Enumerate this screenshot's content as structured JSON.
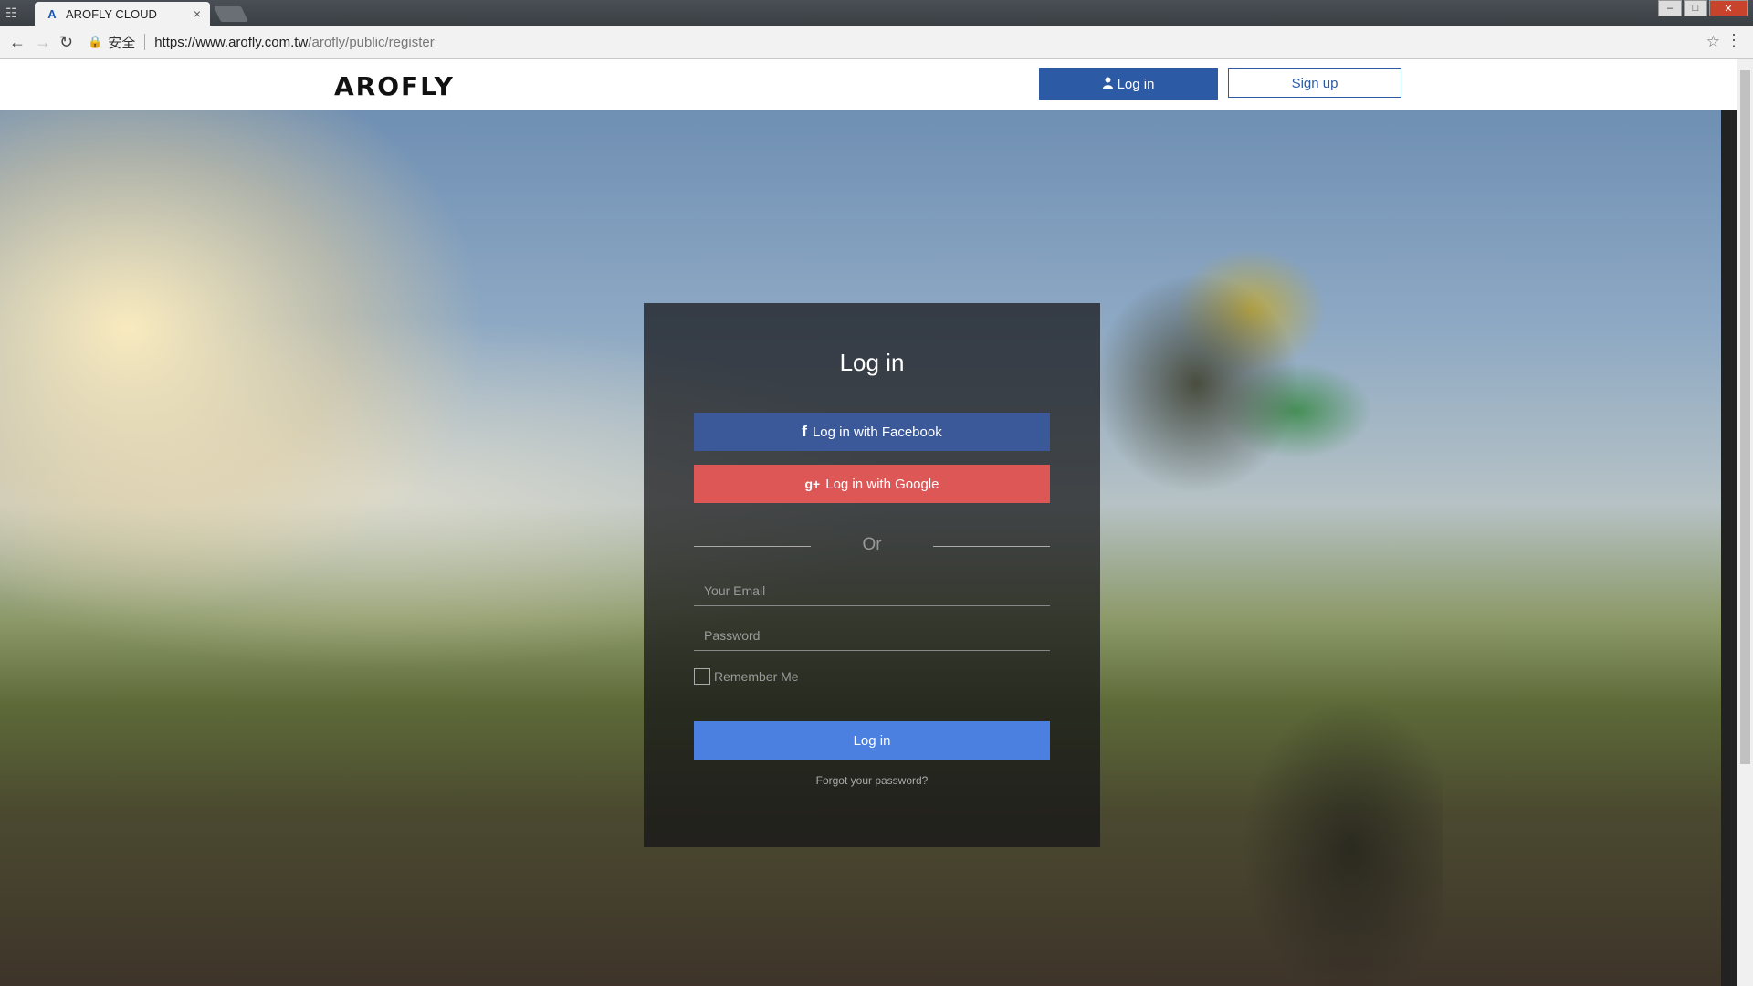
{
  "browser": {
    "tab_title": "AROFLY CLOUD",
    "tab_favicon": "A",
    "tab_close": "×",
    "security_label": "安全",
    "url_host": "https://www.arofly.com.tw",
    "url_path": "/arofly/public/register"
  },
  "header": {
    "logo": "AROFLY",
    "login_label": "Log in",
    "signup_label": "Sign up"
  },
  "login_card": {
    "title": "Log in",
    "facebook_label": "Log in with Facebook",
    "google_label": "Log in with Google",
    "or_label": "Or",
    "email_placeholder": "Your Email",
    "password_placeholder": "Password",
    "remember_label": "Remember Me",
    "submit_label": "Log in",
    "forgot_label": "Forgot your password?"
  },
  "colors": {
    "primary": "#2d5aa5",
    "facebook": "#3b5998",
    "google": "#dd5757",
    "login_button": "#4b7fe0"
  },
  "icons": {
    "user": "user-icon",
    "facebook": "facebook-icon",
    "google_plus": "google-plus-icon"
  }
}
